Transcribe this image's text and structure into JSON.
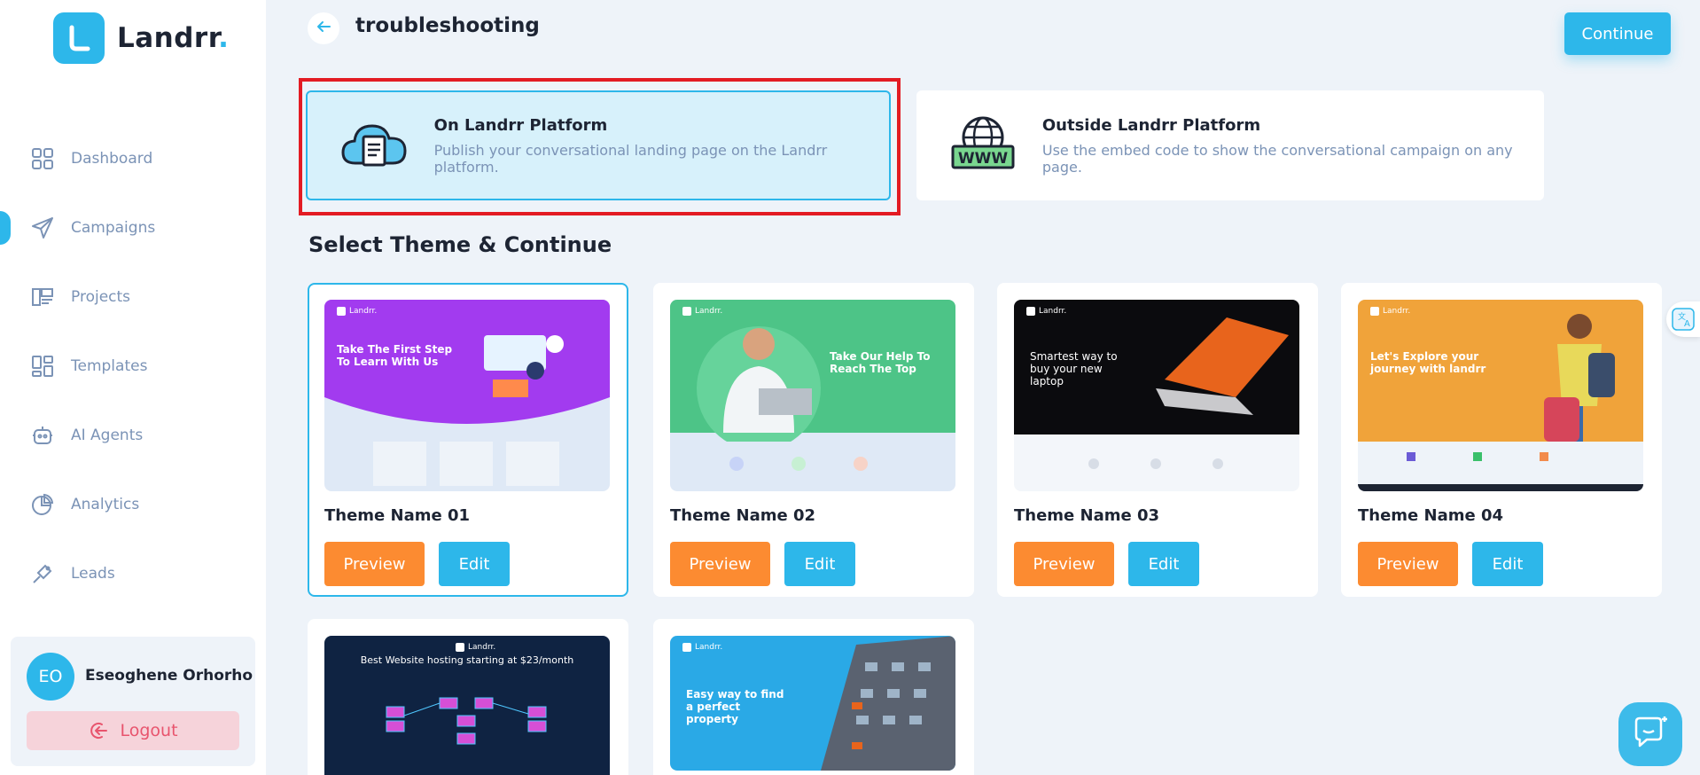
{
  "brand": {
    "name": "Landrr",
    "dot": ".",
    "accent": "#2db7ea"
  },
  "sidebar": {
    "items": [
      {
        "label": "Dashboard",
        "icon": "grid-icon"
      },
      {
        "label": "Campaigns",
        "icon": "paper-plane-icon",
        "active": true
      },
      {
        "label": "Projects",
        "icon": "projects-icon"
      },
      {
        "label": "Templates",
        "icon": "templates-icon"
      },
      {
        "label": "AI Agents",
        "icon": "robot-icon"
      },
      {
        "label": "Analytics",
        "icon": "pie-chart-icon"
      },
      {
        "label": "Leads",
        "icon": "leads-icon"
      }
    ]
  },
  "user": {
    "initials": "EO",
    "name": "Eseoghene Orhorho",
    "logout_label": "Logout"
  },
  "header": {
    "title": "troubleshooting",
    "continue_label": "Continue"
  },
  "platforms": [
    {
      "title": "On Landrr Platform",
      "description": "Publish your conversational landing page on the Landrr platform.",
      "icon": "cloud-document-icon",
      "selected": true
    },
    {
      "title": "Outside Landrr Platform",
      "description": "Use the embed code to show the conversational campaign on any page.",
      "icon": "globe-www-icon",
      "selected": false
    }
  ],
  "section_title": "Select Theme & Continue",
  "themes": [
    {
      "name": "Theme Name 01",
      "preview_label": "Preview",
      "edit_label": "Edit",
      "hero": "Take The First Step To Learn With Us",
      "brand": "Landrr.",
      "selected": true
    },
    {
      "name": "Theme Name 02",
      "preview_label": "Preview",
      "edit_label": "Edit",
      "hero": "Take Our Help To Reach The Top",
      "brand": "Landrr."
    },
    {
      "name": "Theme Name 03",
      "preview_label": "Preview",
      "edit_label": "Edit",
      "hero": "Smartest way to buy your new laptop",
      "brand": "Landrr."
    },
    {
      "name": "Theme Name 04",
      "preview_label": "Preview",
      "edit_label": "Edit",
      "hero": "Let's Explore your journey with landrr",
      "brand": "Landrr."
    },
    {
      "hero": "Best Website hosting starting at $23/month",
      "brand": "Landrr."
    },
    {
      "hero": "Easy way to find a perfect property",
      "brand": "Landrr."
    }
  ]
}
